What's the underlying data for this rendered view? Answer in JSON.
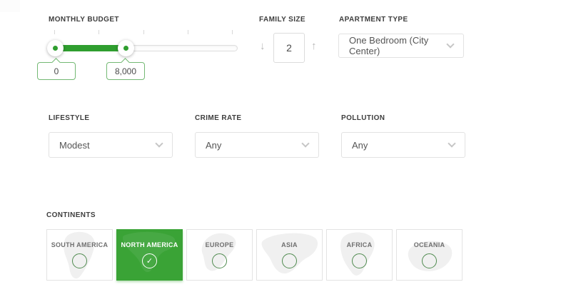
{
  "page": {
    "background": "#ffffff",
    "accent_green": "#3aa336",
    "slider_green": "#2f9e2f"
  },
  "filters": {
    "monthly_budget": {
      "label": "MONTHLY BUDGET",
      "min_value": "0",
      "max_value": "8,000"
    },
    "family_size": {
      "label": "FAMILY SIZE",
      "value": "2",
      "decrement_icon": "↓",
      "increment_icon": "↑"
    },
    "apartment_type": {
      "label": "APARTMENT TYPE",
      "selected": "One Bedroom (City Center)"
    },
    "lifestyle": {
      "label": "LIFESTYLE",
      "selected": "Modest"
    },
    "crime_rate": {
      "label": "CRIME RATE",
      "selected": "Any"
    },
    "pollution": {
      "label": "POLLUTION",
      "selected": "Any"
    }
  },
  "continents": {
    "label": "CONTINENTS",
    "check_icon": "✓",
    "items": [
      {
        "name": "SOUTH AMERICA",
        "selected": false
      },
      {
        "name": "NORTH AMERICA",
        "selected": true
      },
      {
        "name": "EUROPE",
        "selected": false
      },
      {
        "name": "ASIA",
        "selected": false
      },
      {
        "name": "AFRICA",
        "selected": false
      },
      {
        "name": "OCEANIA",
        "selected": false
      }
    ]
  }
}
